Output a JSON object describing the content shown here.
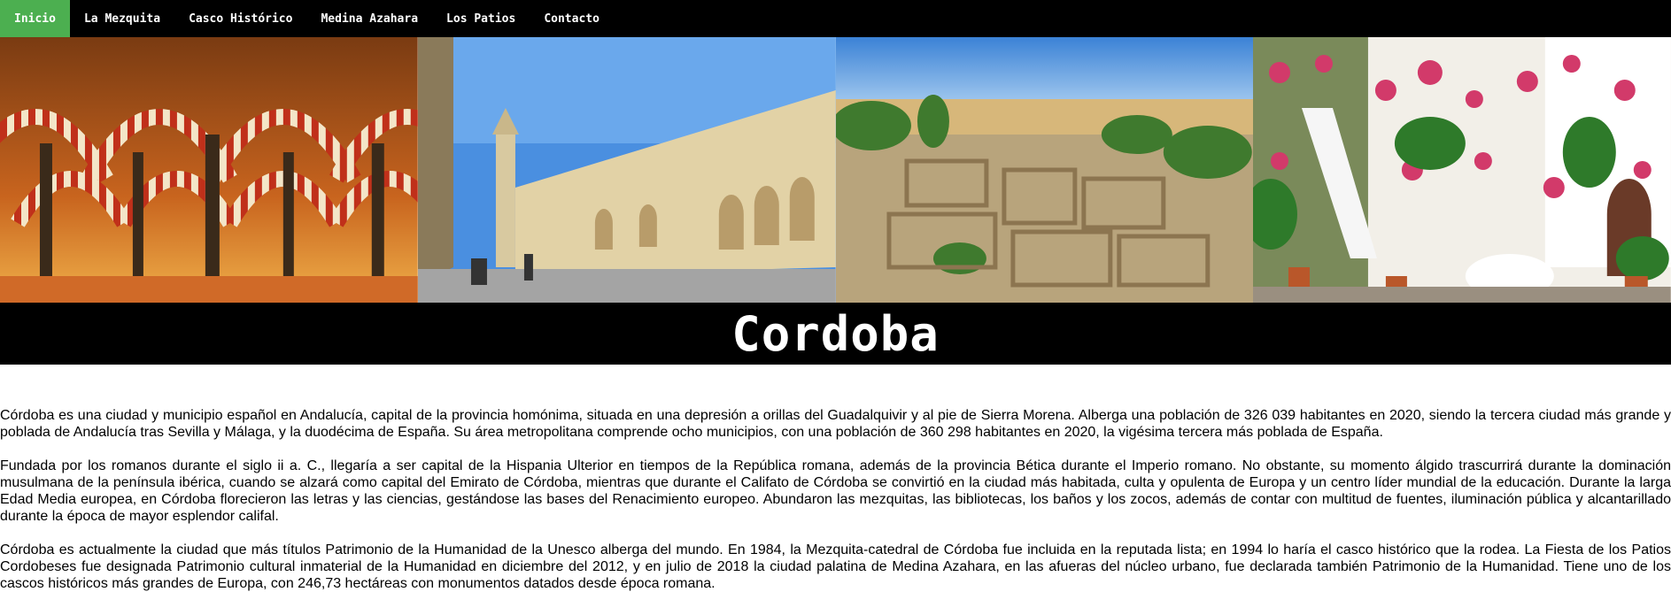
{
  "nav": {
    "items": [
      {
        "label": "Inicio",
        "active": true
      },
      {
        "label": "La Mezquita"
      },
      {
        "label": "Casco Histórico"
      },
      {
        "label": "Medina Azahara"
      },
      {
        "label": "Los Patios"
      },
      {
        "label": "Contacto"
      }
    ],
    "active_color": "#4CAF50"
  },
  "hero": {
    "images": [
      {
        "icon": "mezquita-arches-image"
      },
      {
        "icon": "mezquita-exterior-wall-image"
      },
      {
        "icon": "medina-azahara-ruins-image"
      },
      {
        "icon": "patio-flowers-image"
      }
    ]
  },
  "title": "Cordoba",
  "paragraphs": [
    "Córdoba es una ciudad y municipio español en Andalucía, capital de la provincia homónima, situada en una depresión a orillas del Guadalquivir y al pie de Sierra Morena. Alberga una población de 326 039 habitantes en 2020, siendo la tercera ciudad más grande y poblada de Andalucía tras Sevilla y Málaga, y la duodécima de España. Su área metropolitana comprende ocho municipios, con una población de 360 298 habitantes en 2020, la vigésima tercera más poblada de España.",
    "Fundada por los romanos durante el siglo ii a. C., llegaría a ser capital de la Hispania Ulterior en tiempos de la República romana, además de la provincia Bética durante el Imperio romano. No obstante, su momento álgido trascurrirá durante la dominación musulmana de la península ibérica, cuando se alzará como capital del Emirato de Córdoba, mientras que durante el Califato de Córdoba se convirtió en la ciudad más habitada, culta y opulenta de Europa y un centro líder mundial de la educación. Durante la larga Edad Media europea, en Córdoba florecieron las letras y las ciencias, gestándose las bases del Renacimiento europeo. Abundaron las mezquitas, las bibliotecas, los baños y los zocos, además de contar con multitud de fuentes, iluminación pública y alcantarillado durante la época de mayor esplendor califal.",
    "Córdoba es actualmente la ciudad que más títulos Patrimonio de la Humanidad de la Unesco alberga del mundo. En 1984, la Mezquita-catedral de Córdoba fue incluida en la reputada lista; en 1994 lo haría el casco histórico que la rodea. La Fiesta de los Patios Cordobeses fue designada Patrimonio cultural inmaterial de la Humanidad en diciembre del 2012, y en julio de 2018 la ciudad palatina de Medina Azahara, en las afueras del núcleo urbano, fue declarada también Patrimonio de la Humanidad. Tiene uno de los cascos históricos más grandes de Europa, con 246,73 hectáreas con monumentos datados desde época romana."
  ]
}
